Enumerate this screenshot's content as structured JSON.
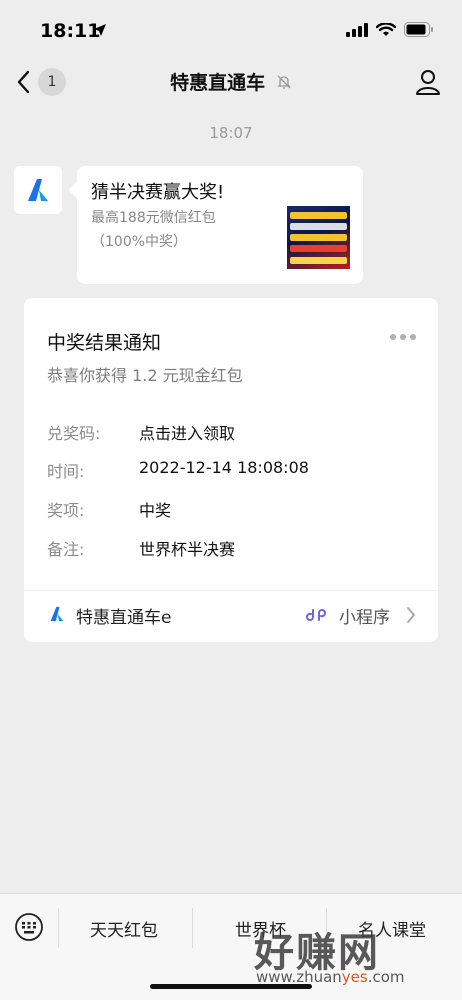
{
  "status_bar": {
    "time": "18:11"
  },
  "header": {
    "back_badge": "1",
    "title": "特惠直通车"
  },
  "chat": {
    "timestamp": "18:07",
    "message": {
      "title": "猜半决赛赢大奖!",
      "description": "最高188元微信红包（100%中奖）",
      "thumbnail_lines": [
        "玩转世界杯",
        "看广告支持球队",
        "即可获得最高",
        "188元微信红包",
        "半决赛即将开启"
      ]
    }
  },
  "card": {
    "title": "中奖结果通知",
    "subtitle": "恭喜你获得 1.2 元现金红包",
    "rows": [
      {
        "label": "兑奖码:",
        "value": "点击进入领取"
      },
      {
        "label": "时间:",
        "value": "2022-12-14 18:08:08"
      },
      {
        "label": "奖项:",
        "value": "中奖"
      },
      {
        "label": "备注:",
        "value": "世界杯半决赛"
      }
    ],
    "footer": {
      "app_name": "特惠直通车e",
      "mini_program_label": "小程序"
    }
  },
  "bottom_menu": {
    "items": [
      "天天红包",
      "世界杯",
      "名人课堂"
    ]
  },
  "watermark": {
    "text": "好赚网",
    "url_prefix": "www.zhuan",
    "url_accent": "yes",
    "url_suffix": ".com"
  },
  "colors": {
    "background": "#ededed",
    "brand_blue": "#1a73e8",
    "mini_program_icon": "#6467f0",
    "watermark_accent": "#e0561c"
  },
  "icons": {
    "location": "location-arrow-icon",
    "signal": "cellular-signal-icon",
    "wifi": "wifi-icon",
    "battery": "battery-icon",
    "back": "chevron-left-icon",
    "mute": "bell-slash-icon",
    "profile": "person-icon",
    "more": "more-dots-icon",
    "mini_program": "link-icon",
    "chevron": "chevron-right-icon",
    "keyboard": "keyboard-icon"
  }
}
